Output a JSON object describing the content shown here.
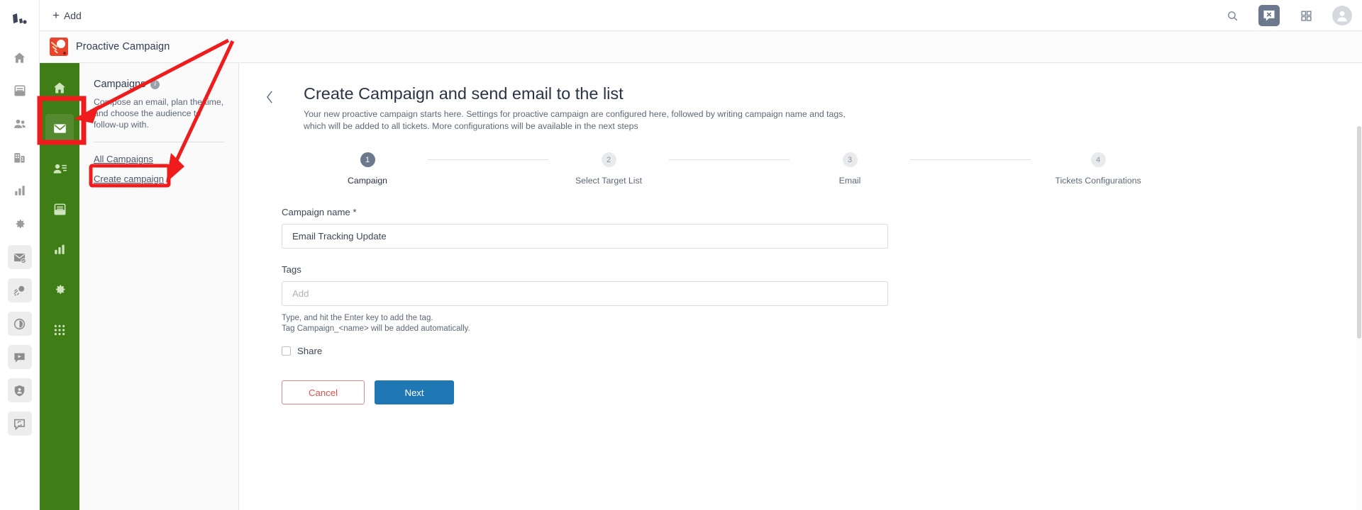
{
  "topbar": {
    "add_label": "Add",
    "icons": [
      "search-icon",
      "chat-x-icon",
      "apps-grid-icon",
      "avatar-icon"
    ]
  },
  "left_rail": {
    "logo": "freshworks-logo",
    "items": [
      {
        "icon": "home-icon",
        "name": "home",
        "boxed": false
      },
      {
        "icon": "inbox-icon",
        "name": "tickets",
        "boxed": false
      },
      {
        "icon": "contacts-icon",
        "name": "contacts",
        "boxed": false
      },
      {
        "icon": "company-icon",
        "name": "companies",
        "boxed": false
      },
      {
        "icon": "bar-chart-icon",
        "name": "reports",
        "boxed": false
      },
      {
        "icon": "gear-icon",
        "name": "admin",
        "boxed": false
      },
      {
        "icon": "mail-check-icon",
        "name": "email-marketing",
        "boxed": true
      },
      {
        "icon": "comet-icon",
        "name": "proactive-campaign",
        "boxed": true
      },
      {
        "icon": "pie-chart-icon",
        "name": "analytics",
        "boxed": true
      },
      {
        "icon": "chat-flag-icon",
        "name": "messaging",
        "boxed": true
      },
      {
        "icon": "shield-user-icon",
        "name": "security",
        "boxed": true
      },
      {
        "icon": "chat-refresh-icon",
        "name": "feedback",
        "boxed": true
      }
    ]
  },
  "product": {
    "logo": "proactive-campaign-logo",
    "title": "Proactive Campaign"
  },
  "green_nav": {
    "items": [
      {
        "icon": "home-icon",
        "name": "home",
        "active": false
      },
      {
        "icon": "mail-icon",
        "name": "campaigns",
        "active": true
      },
      {
        "icon": "contact-list-icon",
        "name": "target-lists",
        "active": false
      },
      {
        "icon": "inbox-icon",
        "name": "templates",
        "active": false
      },
      {
        "icon": "bar-chart-icon",
        "name": "reports",
        "active": false
      },
      {
        "icon": "gear-icon",
        "name": "settings",
        "active": false
      },
      {
        "icon": "grid-dots-icon",
        "name": "apps",
        "active": false
      }
    ]
  },
  "campaigns_panel": {
    "title": "Campaigns",
    "info_badge": "i",
    "description": "Compose an email, plan the time, and choose the audience to follow-up with.",
    "links": [
      {
        "label": "All Campaigns",
        "highlighted": false
      },
      {
        "label": "Create campaign",
        "highlighted": true
      }
    ]
  },
  "main": {
    "back_icon": "chevron-left-icon",
    "title": "Create Campaign and send email to the list",
    "subtitle": "Your new proactive campaign starts here. Settings for proactive campaign are configured here, followed by writing campaign name and tags, which will be added to all tickets. More configurations will be available in the next steps",
    "stepper": [
      {
        "number": "1",
        "label": "Campaign",
        "active": true
      },
      {
        "number": "2",
        "label": "Select Target List",
        "active": false
      },
      {
        "number": "3",
        "label": "Email",
        "active": false
      },
      {
        "number": "4",
        "label": "Tickets Configurations",
        "active": false
      }
    ],
    "form": {
      "campaign_name_label": "Campaign name *",
      "campaign_name_value": "Email Tracking Update",
      "campaign_name_placeholder": "",
      "tags_label": "Tags",
      "tags_value": "",
      "tags_placeholder": "Add",
      "helper_line_1": "Type, and hit the Enter key to add the tag.",
      "helper_line_2": "Tag Campaign_<name> will be added automatically.",
      "share_label": "Share",
      "share_checked": false,
      "cancel_label": "Cancel",
      "next_label": "Next"
    }
  },
  "colors": {
    "green_nav": "#3f7d16",
    "green_nav_active": "#558a30",
    "primary_button": "#1f78b4",
    "cancel_text": "#d9534f",
    "annotation": "#ee1c1c",
    "step_active": "#6b788e",
    "product_logo": "#e8442e"
  },
  "annotations": [
    {
      "type": "box",
      "target": "green-nav-mail-item"
    },
    {
      "type": "box",
      "target": "create-campaign-link"
    },
    {
      "type": "arrow",
      "from": "upper-right",
      "to": "green-nav-mail-item"
    },
    {
      "type": "arrow",
      "from": "upper-right",
      "to": "create-campaign-link"
    }
  ]
}
